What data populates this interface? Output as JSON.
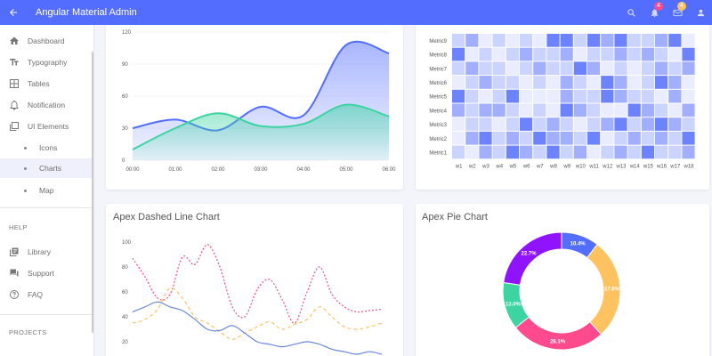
{
  "header": {
    "title": "Angular Material Admin",
    "notifications_count": "4",
    "messages_count": "4",
    "accent": "#536dfe"
  },
  "sidebar": {
    "items": [
      {
        "label": "Dashboard",
        "icon": "home-icon"
      },
      {
        "label": "Typography",
        "icon": "typography-icon"
      },
      {
        "label": "Tables",
        "icon": "table-icon"
      },
      {
        "label": "Notification",
        "icon": "bell-icon"
      },
      {
        "label": "UI Elements",
        "icon": "layers-icon"
      }
    ],
    "sub_items": [
      {
        "label": "Icons"
      },
      {
        "label": "Charts",
        "active": true
      },
      {
        "label": "Map"
      }
    ],
    "help_label": "HELP",
    "help_items": [
      {
        "label": "Library",
        "icon": "library-icon"
      },
      {
        "label": "Support",
        "icon": "forum-icon"
      },
      {
        "label": "FAQ",
        "icon": "help-circle-icon"
      }
    ],
    "projects_label": "PROJECTS"
  },
  "charts": {
    "dashed_title": "Apex Dashed Line Chart",
    "pie_title": "Apex Pie Chart"
  },
  "chart_data": [
    {
      "type": "area",
      "categories": [
        "00:00",
        "01:00",
        "02:00",
        "03:00",
        "04:00",
        "05:00",
        "06:00"
      ],
      "ylim": [
        0,
        120
      ],
      "yticks": [
        0,
        30,
        60,
        90,
        120
      ],
      "series": [
        {
          "values": [
            30,
            38,
            28,
            50,
            42,
            108,
            100
          ],
          "color": "#536dfe"
        },
        {
          "values": [
            10,
            30,
            44,
            32,
            34,
            52,
            41
          ],
          "color": "#3cd4a0"
        }
      ]
    },
    {
      "type": "heatmap",
      "x": [
        "w1",
        "w2",
        "w3",
        "w4",
        "w5",
        "w6",
        "w7",
        "w8",
        "w9",
        "w10",
        "w11",
        "w12",
        "w13",
        "w14",
        "w15",
        "w16",
        "w17",
        "w18"
      ],
      "y": [
        "Metric9",
        "Metric8",
        "Metric7",
        "Metric6",
        "Metric5",
        "Metric4",
        "Metric3",
        "Metric2",
        "Metric1"
      ],
      "values": [
        [
          2,
          3,
          1,
          2,
          1,
          2,
          1,
          4,
          4,
          2,
          4,
          3,
          4,
          2,
          2,
          3,
          4,
          1
        ],
        [
          4,
          1,
          2,
          1,
          2,
          3,
          2,
          2,
          3,
          1,
          2,
          2,
          3,
          2,
          3,
          2,
          1,
          4
        ],
        [
          2,
          3,
          2,
          2,
          1,
          2,
          3,
          2,
          2,
          4,
          3,
          1,
          2,
          1,
          2,
          3,
          2,
          3
        ],
        [
          1,
          2,
          3,
          2,
          2,
          1,
          2,
          1,
          3,
          2,
          1,
          4,
          3,
          1,
          2,
          4,
          3,
          1
        ],
        [
          4,
          2,
          1,
          2,
          4,
          1,
          1,
          1,
          3,
          2,
          2,
          4,
          3,
          2,
          2,
          1,
          3,
          1
        ],
        [
          3,
          2,
          3,
          3,
          2,
          1,
          2,
          1,
          4,
          3,
          2,
          1,
          1,
          4,
          3,
          2,
          1,
          3
        ],
        [
          1,
          2,
          2,
          1,
          2,
          4,
          2,
          3,
          2,
          1,
          2,
          3,
          4,
          2,
          3,
          4,
          3,
          2
        ],
        [
          1,
          3,
          4,
          2,
          3,
          2,
          4,
          3,
          3,
          2,
          4,
          1,
          2,
          3,
          2,
          3,
          2,
          4
        ],
        [
          2,
          1,
          3,
          2,
          4,
          3,
          2,
          4,
          2,
          3,
          1,
          2,
          3,
          2,
          4,
          2,
          2,
          3
        ]
      ],
      "color": "#536dfe"
    },
    {
      "type": "line",
      "title": "Apex Dashed Line Chart",
      "yticks": [
        20,
        40,
        60,
        80,
        100
      ],
      "ylim": [
        10,
        110
      ],
      "series": [
        {
          "values": [
            87,
            72,
            55,
            58,
            88,
            82,
            98,
            80,
            48,
            40,
            62,
            70,
            54,
            35,
            60,
            80,
            58,
            48,
            44,
            45,
            46
          ],
          "color": "#e8577e",
          "dash": "2,2"
        },
        {
          "values": [
            35,
            38,
            46,
            63,
            55,
            40,
            35,
            28,
            22,
            27,
            32,
            36,
            30,
            34,
            38,
            48,
            40,
            32,
            30,
            32,
            35
          ],
          "color": "#f7c46a",
          "dash": "4,3"
        },
        {
          "values": [
            44,
            48,
            52,
            48,
            45,
            38,
            30,
            29,
            33,
            27,
            20,
            18,
            16,
            18,
            20,
            18,
            14,
            12,
            10,
            12,
            10
          ],
          "color": "#6a86d9",
          "dash": ""
        }
      ]
    },
    {
      "type": "pie",
      "title": "Apex Pie Chart",
      "labels": [
        "10.4%",
        "27.8%",
        "26.1%",
        "13.0%",
        "22.7%"
      ],
      "values": [
        10.4,
        27.8,
        26.1,
        13.0,
        22.7
      ],
      "colors": [
        "#536dfe",
        "#ffc260",
        "#ff4a8e",
        "#3cd4a0",
        "#9013fe"
      ]
    }
  ]
}
